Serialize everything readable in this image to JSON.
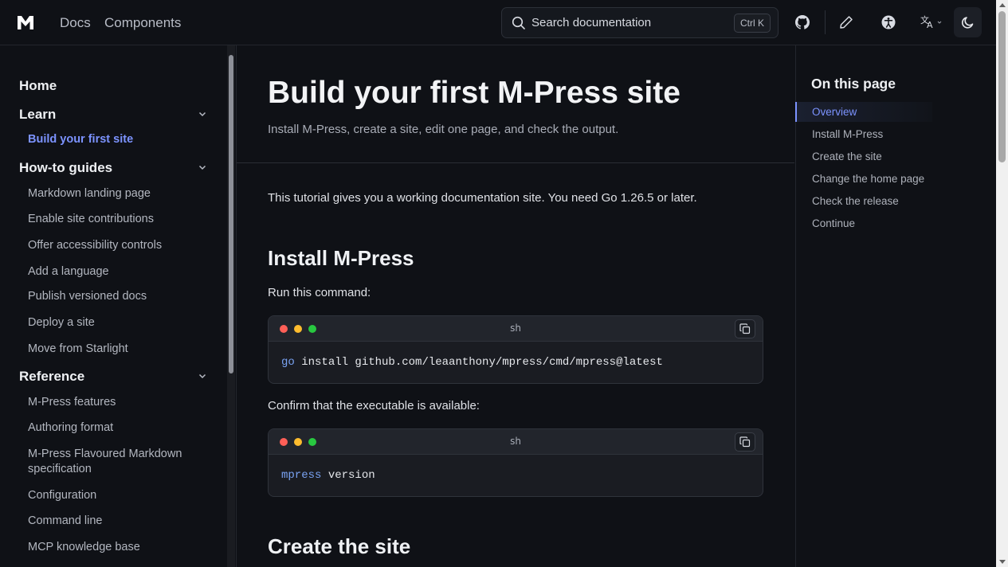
{
  "header": {
    "nav": [
      "Docs",
      "Components"
    ],
    "search_placeholder": "Search documentation",
    "search_shortcut": "Ctrl K",
    "icons": [
      "github-icon",
      "pencil-icon",
      "accessibility-icon",
      "translate-icon",
      "moon-icon"
    ]
  },
  "sidebar": {
    "home": "Home",
    "groups": [
      {
        "label": "Learn",
        "items": [
          "Build your first site"
        ]
      },
      {
        "label": "How-to guides",
        "items": [
          "Markdown landing page",
          "Enable site contributions",
          "Offer accessibility controls",
          "Add a language",
          "Publish versioned docs",
          "Deploy a site",
          "Move from Starlight"
        ]
      },
      {
        "label": "Reference",
        "items": [
          "M-Press features",
          "Authoring format",
          "M-Press Flavoured Markdown",
          "specification",
          "Configuration",
          "Command line",
          "MCP knowledge base"
        ]
      }
    ]
  },
  "main": {
    "title": "Build your first M-Press site",
    "subtitle": "Install M-Press, create a site, edit one page, and check the output.",
    "intro": "This tutorial gives you a working documentation site. You need Go 1.26.5 or later.",
    "section1": "Install M-Press",
    "run_cmd": "Run this command:",
    "code1": {
      "lang": "sh",
      "cmd": "go",
      "rest": " install github.com/leaanthony/mpress/cmd/mpress@latest"
    },
    "confirm": "Confirm that the executable is available:",
    "code2": {
      "lang": "sh",
      "cmd": "mpress",
      "rest": " version"
    },
    "section2": "Create the site"
  },
  "toc": {
    "title": "On this page",
    "items": [
      "Overview",
      "Install M-Press",
      "Create the site",
      "Change the home page",
      "Check the release",
      "Continue"
    ]
  },
  "colors": {
    "accent": "#7c93ff",
    "bg": "#0f1116"
  }
}
